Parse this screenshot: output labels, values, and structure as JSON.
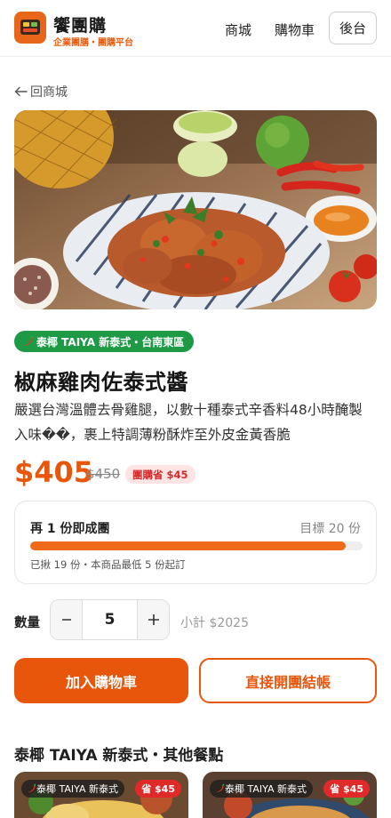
{
  "header": {
    "brand_name": "饗團購",
    "brand_subtitle": "企業團膳・團購平台",
    "nav": {
      "mall": "商城",
      "cart": "購物車"
    },
    "admin_label": "後台"
  },
  "back": {
    "label": "回商城"
  },
  "product": {
    "store_tag": "泰椰 TAIYA 新泰式・台南東區",
    "title": "椒麻雞肉佐泰式醬",
    "description": "嚴選台灣溫體去骨雞腿，以數十種泰式辛香料48小時醃製入味��，裹上特調薄粉酥炸至外皮金黃香脆",
    "price": "$405",
    "original_price": "$450",
    "save_badge": "團購省 $45"
  },
  "group_progress": {
    "title": "再 1 份即成團",
    "target": "目標 20 份",
    "progress_fraction": 0.95,
    "footnote": "已揪 19 份・本商品最低 5 份起訂"
  },
  "quantity": {
    "label": "數量",
    "value": "5",
    "subtotal": "小計 $2025"
  },
  "actions": {
    "add_to_cart": "加入購物車",
    "checkout": "直接開團結帳"
  },
  "other_items": {
    "title": "泰椰 TAIYA 新泰式・其他餐點",
    "cards": [
      {
        "store": "泰椰 TAIYA 新泰式",
        "save": "省 $45"
      },
      {
        "store": "泰椰 TAIYA 新泰式",
        "save": "省 $45"
      }
    ]
  },
  "colors": {
    "accent": "#e8560c",
    "store_tag_green": "#1e9a47",
    "save_badge_bg": "#fde4e4",
    "save_badge_text": "#d42a2a"
  }
}
